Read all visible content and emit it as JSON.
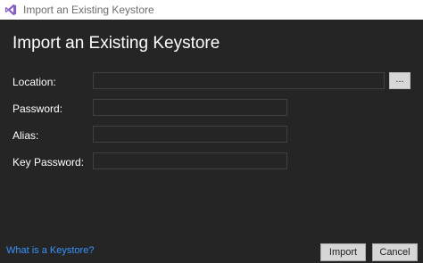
{
  "window": {
    "title": "Import an Existing Keystore"
  },
  "page": {
    "title": "Import an Existing Keystore"
  },
  "form": {
    "location": {
      "label": "Location:",
      "value": ""
    },
    "password": {
      "label": "Password:",
      "value": ""
    },
    "alias": {
      "label": "Alias:",
      "value": ""
    },
    "key_password": {
      "label": "Key Password:",
      "value": ""
    },
    "browse_label": "..."
  },
  "footer": {
    "help_link": "What is a Keystore?",
    "import_label": "Import",
    "cancel_label": "Cancel"
  },
  "icons": {
    "app": "visual-studio-icon"
  },
  "colors": {
    "accent": "#3794ff",
    "background": "#252526",
    "titlebar": "#ffffff"
  }
}
